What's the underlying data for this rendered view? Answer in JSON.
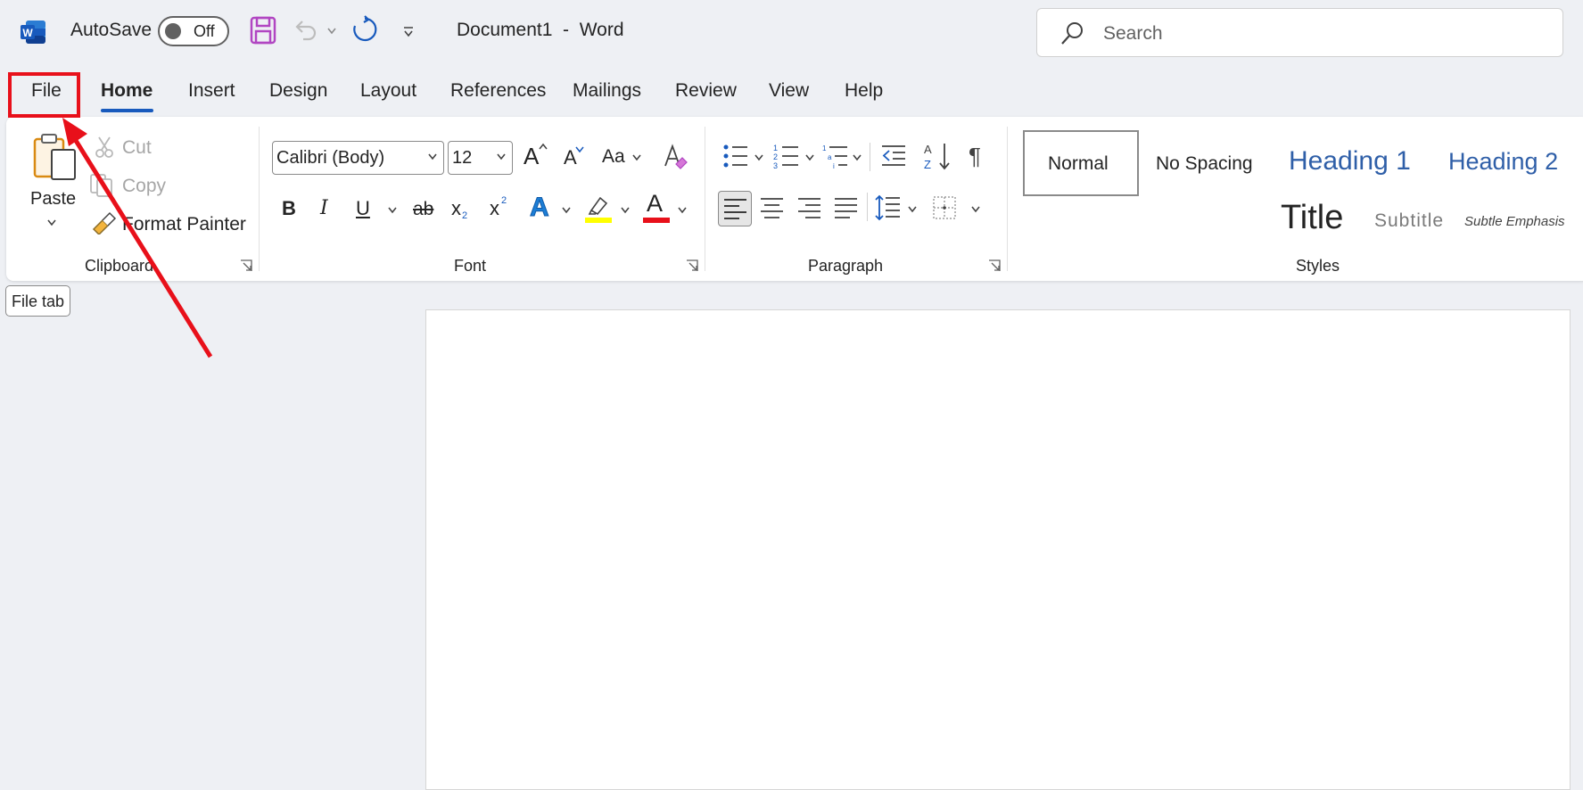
{
  "titlebar": {
    "app_icon": "word-logo-icon",
    "autosave_label": "AutoSave",
    "autosave_state": "Off",
    "document_name": "Document1  -  Word",
    "search_placeholder": "Search"
  },
  "tabs": [
    {
      "label": "File"
    },
    {
      "label": "Home",
      "active": true
    },
    {
      "label": "Insert"
    },
    {
      "label": "Design"
    },
    {
      "label": "Layout"
    },
    {
      "label": "References"
    },
    {
      "label": "Mailings"
    },
    {
      "label": "Review"
    },
    {
      "label": "View"
    },
    {
      "label": "Help"
    }
  ],
  "clipboard": {
    "group_label": "Clipboard",
    "paste": "Paste",
    "cut": "Cut",
    "copy": "Copy",
    "format_painter": "Format Painter"
  },
  "font": {
    "group_label": "Font",
    "font_name": "Calibri (Body)",
    "font_size": "12",
    "change_case": "Aa",
    "bold": "B",
    "italic": "I",
    "underline": "U",
    "strikethrough": "ab",
    "subscript": "x",
    "subscript_mark": "2",
    "superscript": "x",
    "superscript_mark": "2",
    "text_effects": "A",
    "font_color": "A",
    "grow": "A",
    "shrink": "A",
    "highlight_color": "#ffff00",
    "font_color_value": "#e8101a"
  },
  "paragraph": {
    "group_label": "Paragraph"
  },
  "styles": {
    "group_label": "Styles",
    "items": [
      "Normal",
      "No Spacing",
      "Heading 1",
      "Heading 2",
      "Title",
      "Subtitle",
      "Subtle Emphasis"
    ]
  },
  "tooltip": "File tab",
  "colors": {
    "accent": "#185abd",
    "annotation_red": "#e8101a",
    "heading_blue": "#2f5fa8"
  }
}
